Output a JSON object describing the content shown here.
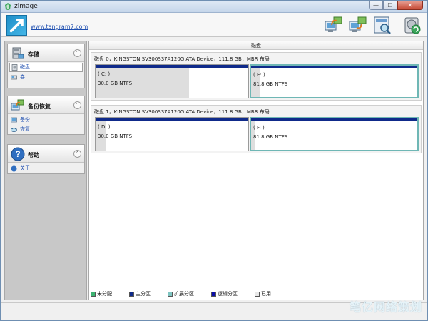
{
  "app": {
    "title": "zimage",
    "site_link": "www.tangram7.com"
  },
  "toolbar": {
    "buttons": [
      "toolbar-backup-icon",
      "toolbar-restore-icon",
      "toolbar-search-icon",
      "toolbar-refresh-icon"
    ]
  },
  "sidebar": {
    "storage": {
      "title": "存储",
      "items": [
        "磁盘",
        "卷"
      ]
    },
    "backup": {
      "title": "备份恢复",
      "items": [
        "备份",
        "恢复"
      ]
    },
    "help": {
      "title": "帮助",
      "items": [
        "关于"
      ]
    }
  },
  "main": {
    "header": "磁盘",
    "disks": [
      {
        "label": "磁盘 0，KINGSTON SV300S37A120G ATA Device，111.8 GB，MBR 布局",
        "partitions": [
          {
            "letter": "( C: )",
            "info": "30.0 GB NTFS",
            "used": 0.61
          },
          {
            "letter": "( E: )",
            "info": "81.8 GB NTFS",
            "used": 0.05
          }
        ]
      },
      {
        "label": "磁盘 1，KINGSTON SV300S37A120G ATA Device，111.8 GB，MBR 布局",
        "partitions": [
          {
            "letter": "( D: )",
            "info": "30.0 GB NTFS",
            "used": 0.07
          },
          {
            "letter": "( F: )",
            "info": "81.8 GB NTFS",
            "used": 0.02
          }
        ]
      }
    ]
  },
  "legend": [
    {
      "label": "未分配",
      "color": "#3cb371"
    },
    {
      "label": "主分区",
      "color": "#0f2a8a"
    },
    {
      "label": "扩展分区",
      "color": "#7fc5c2"
    },
    {
      "label": "逻辑分区",
      "color": "#0b0fa8"
    },
    {
      "label": "已用",
      "color": "#e8e8e8"
    }
  ],
  "watermark": "笔亿网络策划"
}
